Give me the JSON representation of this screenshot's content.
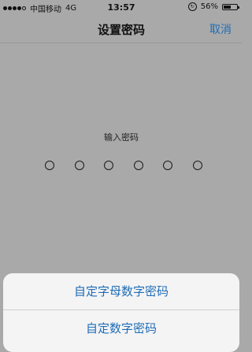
{
  "status_bar": {
    "carrier": "中国移动",
    "network": "4G",
    "time": "13:57",
    "battery_percent": "56%",
    "battery_level": 0.56
  },
  "nav": {
    "title": "设置密码",
    "cancel": "取消"
  },
  "passcode": {
    "prompt": "输入密码",
    "digits_total": 6,
    "digits_entered": 0
  },
  "action_sheet": {
    "options": [
      {
        "label": "自定字母数字密码"
      },
      {
        "label": "自定数字密码"
      }
    ]
  },
  "colors": {
    "accent": "#1f6db5",
    "dimmed_background": "#a9a9a9",
    "sheet_background": "#f4f4f5"
  }
}
